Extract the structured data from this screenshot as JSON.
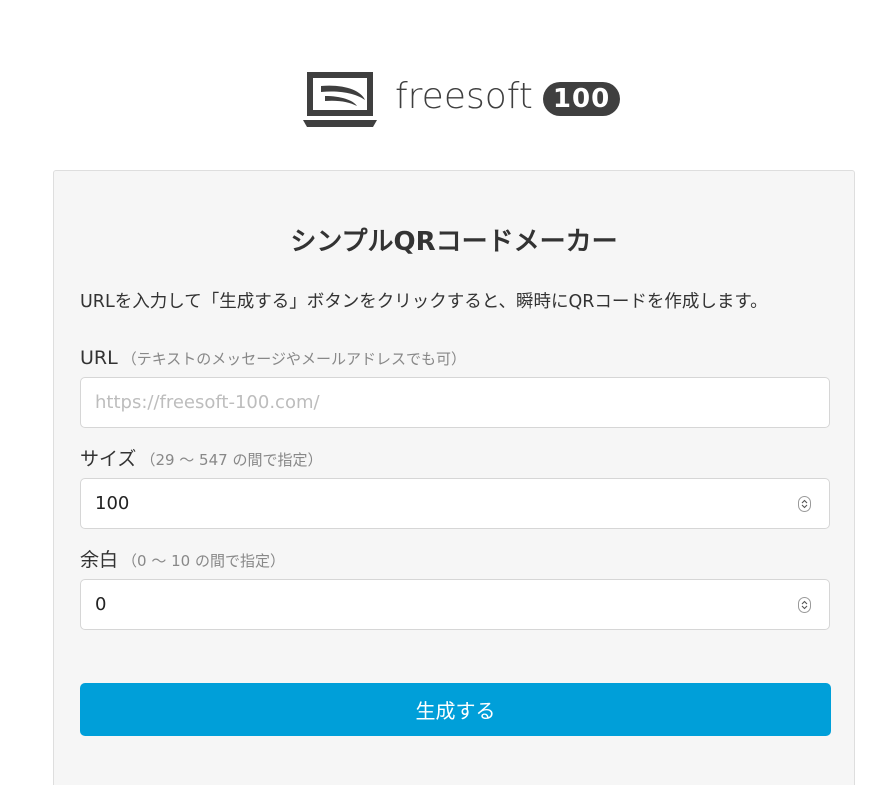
{
  "logo": {
    "wordmark": "freesoft",
    "badge": "100"
  },
  "form": {
    "title": "シンプルQRコードメーカー",
    "description": "URLを入力して「生成する」ボタンをクリックすると、瞬時にQRコードを作成します。",
    "url": {
      "label": "URL",
      "hint": "（テキストのメッセージやメールアドレスでも可）",
      "placeholder": "https://freesoft-100.com/",
      "value": ""
    },
    "size": {
      "label": "サイズ",
      "hint": "（29 〜 547 の間で指定）",
      "value": "100"
    },
    "margin": {
      "label": "余白",
      "hint": "（0 〜 10 の間で指定）",
      "value": "0"
    },
    "submit_label": "生成する"
  },
  "colors": {
    "accent": "#009fd9",
    "card_background": "#f6f6f6",
    "logo": "#3f3f3f"
  }
}
